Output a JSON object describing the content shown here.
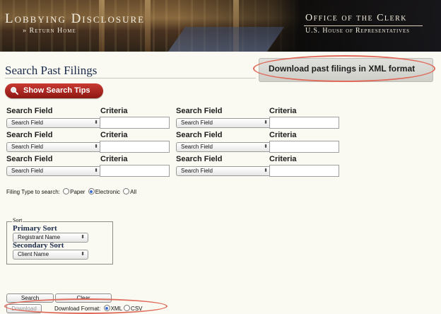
{
  "banner": {
    "title": "Lobbying Disclosure",
    "return_link": "» Return Home",
    "office": "Office of the Clerk",
    "house": "U.S. House of Representatives"
  },
  "page_title": "Search Past Filings",
  "xml_download_label": "Download past filings in XML format",
  "tips_button_label": "Show Search Tips",
  "search_grid": {
    "field_header": "Search Field",
    "criteria_header": "Criteria",
    "select_value": "Search Field",
    "rows": [
      {
        "left_field": "Search Field",
        "left_criteria": "",
        "right_field": "Search Field",
        "right_criteria": ""
      },
      {
        "left_field": "Search Field",
        "left_criteria": "",
        "right_field": "Search Field",
        "right_criteria": ""
      },
      {
        "left_field": "Search Field",
        "left_criteria": "",
        "right_field": "Search Field",
        "right_criteria": ""
      }
    ]
  },
  "filing_type": {
    "label": "Filing Type to search:",
    "options": [
      "Paper",
      "Electronic",
      "All"
    ],
    "selected": "Electronic"
  },
  "sort": {
    "legend": "Sort",
    "primary_label": "Primary Sort",
    "primary_value": "Registrant Name",
    "secondary_label": "Secondary Sort",
    "secondary_value": "Client Name"
  },
  "buttons": {
    "search": "Search",
    "clear": "Clear",
    "download": "Download"
  },
  "download_format": {
    "label": "Download Format:",
    "options": [
      "XML",
      "CSV"
    ],
    "selected": "XML"
  },
  "colors": {
    "accent_red": "#b0241d",
    "highlight_ellipse": "#e06a5a",
    "background": "#fafaf2"
  }
}
